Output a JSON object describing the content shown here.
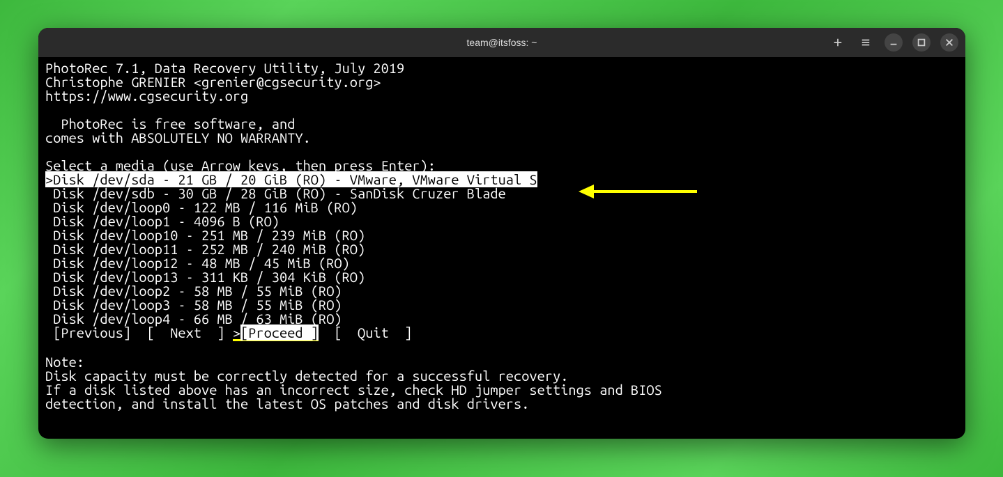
{
  "titlebar": {
    "title": "team@itsfoss: ~"
  },
  "header": {
    "line1": "PhotoRec 7.1, Data Recovery Utility, July 2019",
    "line2": "Christophe GRENIER <grenier@cgsecurity.org>",
    "line3": "https://www.cgsecurity.org"
  },
  "intro": {
    "line1": "  PhotoRec is free software, and",
    "line2": "comes with ABSOLUTELY NO WARRANTY."
  },
  "prompt": "Select a media (use Arrow keys, then press Enter):",
  "disks": {
    "selected": ">Disk /dev/sda - 21 GB / 20 GiB (RO) - VMware, VMware Virtual S",
    "items": [
      " Disk /dev/sdb - 30 GB / 28 GiB (RO) - SanDisk Cruzer Blade",
      " Disk /dev/loop0 - 122 MB / 116 MiB (RO)",
      " Disk /dev/loop1 - 4096 B (RO)",
      " Disk /dev/loop10 - 251 MB / 239 MiB (RO)",
      " Disk /dev/loop11 - 252 MB / 240 MiB (RO)",
      " Disk /dev/loop12 - 48 MB / 45 MiB (RO)",
      " Disk /dev/loop13 - 311 KB / 304 KiB (RO)",
      " Disk /dev/loop2 - 58 MB / 55 MiB (RO)",
      " Disk /dev/loop3 - 58 MB / 55 MiB (RO)",
      " Disk /dev/loop4 - 66 MB / 63 MiB (RO)"
    ]
  },
  "menu": {
    "previous": " [Previous]  ",
    "next": "[  Next  ] ",
    "proceed_marker": ">",
    "proceed": "[Proceed ]",
    "quit": "  [  Quit  ]"
  },
  "note": {
    "heading": "Note:",
    "line1": "Disk capacity must be correctly detected for a successful recovery.",
    "line2": "If a disk listed above has an incorrect size, check HD jumper settings and BIOS",
    "line3": "detection, and install the latest OS patches and disk drivers."
  }
}
